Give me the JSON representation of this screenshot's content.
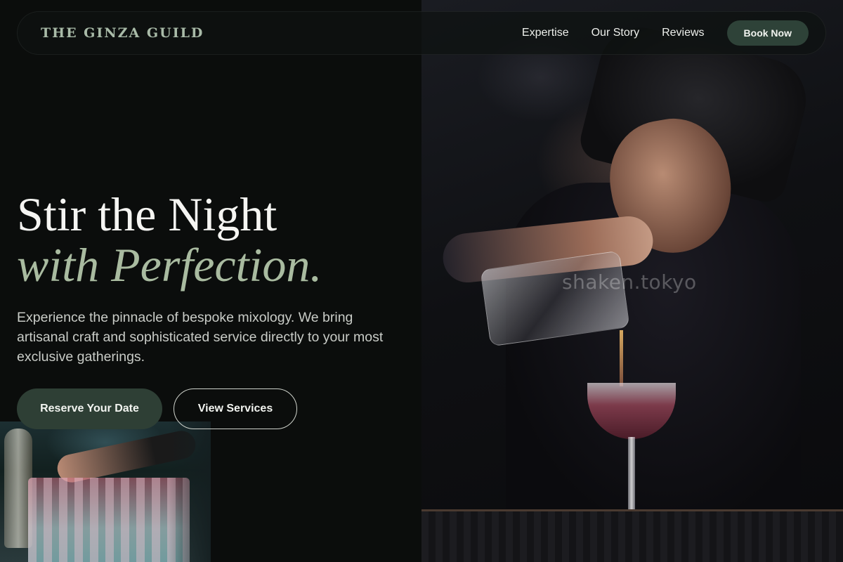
{
  "brand": {
    "name": "THE GINZA GUILD"
  },
  "nav": {
    "links": [
      "Expertise",
      "Our Story",
      "Reviews"
    ],
    "cta": "Book Now"
  },
  "hero": {
    "headline_line1": "Stir the Night",
    "headline_line2": "with Perfection.",
    "subtext": "Experience the pinnacle of bespoke mixology. We bring artisanal craft and sophisticated service directly to your most exclusive gatherings.",
    "primary_cta": "Reserve Your Date",
    "secondary_cta": "View Services",
    "photo_watermark": "shaken.tokyo"
  },
  "colors": {
    "background": "#0b0d0c",
    "accent_green": "#2e4238",
    "headline_italic": "#a9bba0",
    "brand_text": "#a9bba8"
  }
}
